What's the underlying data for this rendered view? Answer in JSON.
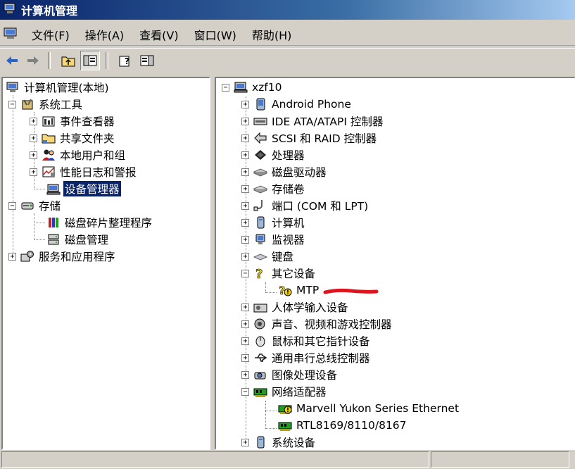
{
  "window": {
    "title": "计算机管理"
  },
  "menu": {
    "items": [
      {
        "label": "文件(F)"
      },
      {
        "label": "操作(A)"
      },
      {
        "label": "查看(V)"
      },
      {
        "label": "窗口(W)"
      },
      {
        "label": "帮助(H)"
      }
    ]
  },
  "toolbar": {
    "buttons": [
      "back-icon",
      "forward-icon",
      "up-folder-icon",
      "show-hide-console-tree-icon",
      "help-icon",
      "action-pane-icon"
    ]
  },
  "left_tree": {
    "root": "计算机管理(本地)",
    "items": [
      {
        "label": "系统工具"
      },
      {
        "label": "事件查看器"
      },
      {
        "label": "共享文件夹"
      },
      {
        "label": "本地用户和组"
      },
      {
        "label": "性能日志和警报"
      },
      {
        "label": "设备管理器",
        "selected": true
      },
      {
        "label": "存储"
      },
      {
        "label": "磁盘碎片整理程序"
      },
      {
        "label": "磁盘管理"
      },
      {
        "label": "服务和应用程序"
      }
    ]
  },
  "device_tree": {
    "root": "xzf10",
    "items": [
      {
        "label": "Android Phone"
      },
      {
        "label": "IDE ATA/ATAPI 控制器"
      },
      {
        "label": "SCSI 和 RAID 控制器"
      },
      {
        "label": "处理器"
      },
      {
        "label": "磁盘驱动器"
      },
      {
        "label": "存储卷"
      },
      {
        "label": "端口 (COM 和 LPT)"
      },
      {
        "label": "计算机"
      },
      {
        "label": "监视器"
      },
      {
        "label": "键盘"
      },
      {
        "label": "其它设备"
      },
      {
        "label": "MTP"
      },
      {
        "label": "人体学输入设备"
      },
      {
        "label": "声音、视频和游戏控制器"
      },
      {
        "label": "鼠标和其它指针设备"
      },
      {
        "label": "通用串行总线控制器"
      },
      {
        "label": "图像处理设备"
      },
      {
        "label": "网络适配器"
      },
      {
        "label": "Marvell Yukon Series Ethernet"
      },
      {
        "label": "RTL8169/8110/8167"
      },
      {
        "label": "系统设备"
      }
    ]
  },
  "colors": {
    "title_bar": "#0a246a",
    "selection": "#0a246a",
    "annotation": "#e0141e",
    "warning": "#f0d000"
  }
}
